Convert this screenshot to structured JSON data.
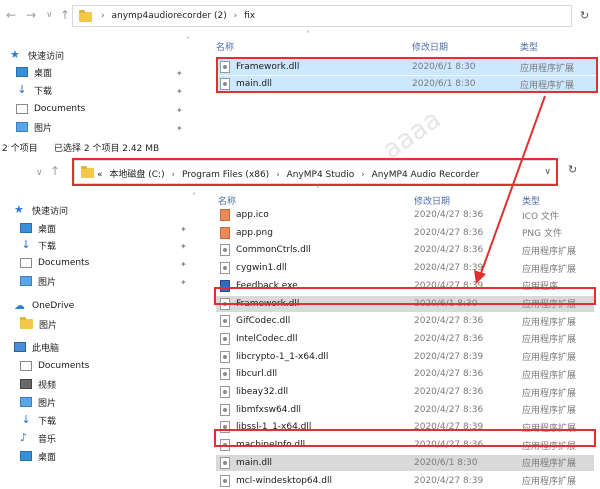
{
  "top": {
    "address": {
      "crumbs": [
        "anymp4audiorecorder (2)",
        "fix"
      ]
    },
    "sidebar": [
      {
        "label": "快速访问",
        "icon": "star-icon"
      },
      {
        "label": "桌面",
        "icon": "desktop-icon"
      },
      {
        "label": "下载",
        "icon": "download-icon"
      },
      {
        "label": "Documents",
        "icon": "documents-icon"
      },
      {
        "label": "图片",
        "icon": "pictures-icon"
      }
    ],
    "columns": {
      "name": "名称",
      "date": "修改日期",
      "type": "类型"
    },
    "files": [
      {
        "name": "Framework.dll",
        "date": "2020/6/1 8:30",
        "type": "应用程序扩展"
      },
      {
        "name": "main.dll",
        "date": "2020/6/1 8:30",
        "type": "应用程序扩展"
      }
    ],
    "status": {
      "count": "2 个项目",
      "selected": "已选择 2 个项目 2.42 MB"
    }
  },
  "bottom": {
    "address": {
      "prefix": "«",
      "crumbs": [
        "本地磁盘 (C:)",
        "Program Files (x86)",
        "AnyMP4 Studio",
        "AnyMP4 Audio Recorder"
      ]
    },
    "sidebar": [
      {
        "label": "快速访问",
        "icon": "star-icon"
      },
      {
        "label": "桌面",
        "icon": "desktop-icon"
      },
      {
        "label": "下载",
        "icon": "download-icon"
      },
      {
        "label": "Documents",
        "icon": "documents-icon"
      },
      {
        "label": "图片",
        "icon": "pictures-icon"
      },
      {
        "label": "OneDrive",
        "icon": "onedrive-icon"
      },
      {
        "label": "图片",
        "icon": "pictures-icon"
      },
      {
        "label": "此电脑",
        "icon": "this-pc-icon"
      },
      {
        "label": "Documents",
        "icon": "documents-icon"
      },
      {
        "label": "视频",
        "icon": "videos-icon"
      },
      {
        "label": "图片",
        "icon": "pictures-icon"
      },
      {
        "label": "下载",
        "icon": "download-icon"
      },
      {
        "label": "音乐",
        "icon": "music-icon"
      },
      {
        "label": "桌面",
        "icon": "desktop-icon"
      }
    ],
    "columns": {
      "name": "名称",
      "date": "修改日期",
      "type": "类型"
    },
    "files": [
      {
        "name": "app.ico",
        "date": "2020/4/27 8:36",
        "type": "ICO 文件",
        "icon": "img"
      },
      {
        "name": "app.png",
        "date": "2020/4/27 8:36",
        "type": "PNG 文件",
        "icon": "img"
      },
      {
        "name": "CommonCtrls.dll",
        "date": "2020/4/27 8:36",
        "type": "应用程序扩展",
        "icon": "gear"
      },
      {
        "name": "cygwin1.dll",
        "date": "2020/4/27 8:39",
        "type": "应用程序扩展",
        "icon": "gear"
      },
      {
        "name": "Feedback.exe",
        "date": "2020/4/27 8:39",
        "type": "应用程序",
        "icon": "exe"
      },
      {
        "name": "Framework.dll",
        "date": "2020/6/1 8:30",
        "type": "应用程序扩展",
        "icon": "gear"
      },
      {
        "name": "GifCodec.dll",
        "date": "2020/4/27 8:36",
        "type": "应用程序扩展",
        "icon": "gear"
      },
      {
        "name": "IntelCodec.dll",
        "date": "2020/4/27 8:36",
        "type": "应用程序扩展",
        "icon": "gear"
      },
      {
        "name": "libcrypto-1_1-x64.dll",
        "date": "2020/4/27 8:39",
        "type": "应用程序扩展",
        "icon": "gear"
      },
      {
        "name": "libcurl.dll",
        "date": "2020/4/27 8:36",
        "type": "应用程序扩展",
        "icon": "gear"
      },
      {
        "name": "libeay32.dll",
        "date": "2020/4/27 8:36",
        "type": "应用程序扩展",
        "icon": "gear"
      },
      {
        "name": "libmfxsw64.dll",
        "date": "2020/4/27 8:36",
        "type": "应用程序扩展",
        "icon": "gear"
      },
      {
        "name": "libssl-1_1-x64.dll",
        "date": "2020/4/27 8:39",
        "type": "应用程序扩展",
        "icon": "gear"
      },
      {
        "name": "machineInfo.dll",
        "date": "2020/4/27 8:36",
        "type": "应用程序扩展",
        "icon": "gear"
      },
      {
        "name": "main.dll",
        "date": "2020/6/1 8:30",
        "type": "应用程序扩展",
        "icon": "gear"
      },
      {
        "name": "mcl-windesktop64.dll",
        "date": "2020/4/27 8:39",
        "type": "应用程序扩展",
        "icon": "gear"
      }
    ]
  },
  "colors": {
    "highlight_red": "#e03030",
    "selection": "#cce8ff",
    "replaced_row": "#d9d9d9"
  }
}
